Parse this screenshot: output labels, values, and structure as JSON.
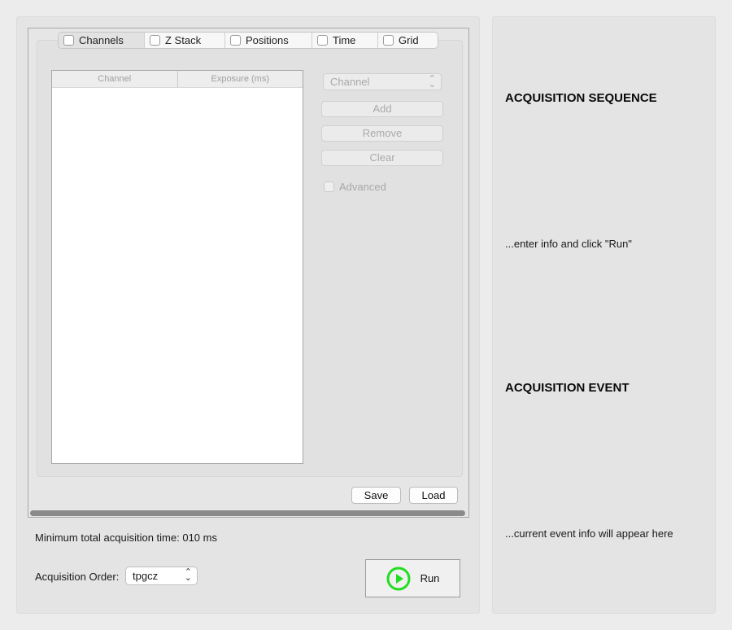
{
  "tabs": [
    {
      "label": "Channels",
      "checked": false,
      "active": true
    },
    {
      "label": "Z Stack",
      "checked": false,
      "active": false
    },
    {
      "label": "Positions",
      "checked": false,
      "active": false
    },
    {
      "label": "Time",
      "checked": false,
      "active": false
    },
    {
      "label": "Grid",
      "checked": false,
      "active": false
    }
  ],
  "channels": {
    "table": {
      "columns": [
        "Channel",
        "Exposure (ms)"
      ],
      "rows": []
    },
    "channel_select": {
      "value": "Channel",
      "enabled": false
    },
    "buttons": {
      "add": "Add",
      "remove": "Remove",
      "clear": "Clear"
    },
    "advanced": {
      "label": "Advanced",
      "checked": false,
      "enabled": false
    }
  },
  "file": {
    "save": "Save",
    "load": "Load"
  },
  "min_time": "Minimum total acquisition time: 010 ms",
  "order": {
    "label": "Acquisition Order:",
    "value": "tpgcz"
  },
  "run": {
    "label": "Run",
    "icon": "play-circle-icon",
    "icon_color": "#22dd22"
  },
  "sidebar": {
    "sequence_heading": "ACQUISITION SEQUENCE",
    "sequence_info": "...enter info and click \"Run\"",
    "event_heading": "ACQUISITION EVENT",
    "event_info": "...current event info will appear here"
  }
}
